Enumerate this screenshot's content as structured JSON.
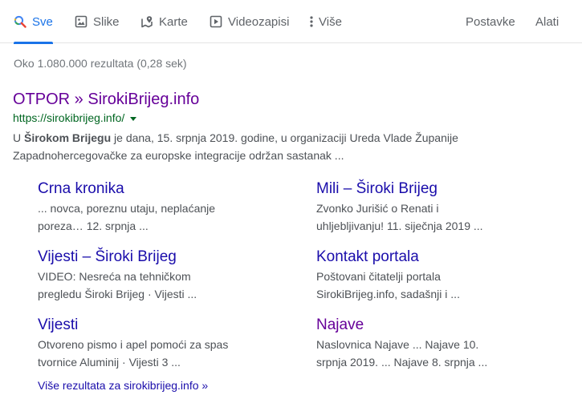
{
  "tabs": {
    "all": "Sve",
    "images": "Slike",
    "maps": "Karte",
    "videos": "Videozapisi",
    "more": "Više",
    "settings": "Postavke",
    "tools": "Alati"
  },
  "stats": "Oko 1.080.000 rezultata (0,28 sek)",
  "result": {
    "title": "OTPOR » SirokiBrijeg.info",
    "url": "https://sirokibrijeg.info/",
    "snippet_pre": "U ",
    "snippet_bold": "Širokom Brijegu",
    "snippet_post": " je dana, 15. srpnja 2019. godine, u organizaciji Ureda Vlade Županije Zapadnohercegovačke za europske integracije održan sastanak ..."
  },
  "sitelinks": [
    {
      "title": "Crna kronika",
      "desc": "... novca, poreznu utaju, neplaćanje poreza… 12. srpnja ..."
    },
    {
      "title": "Mili – Široki Brijeg",
      "desc": "Zvonko Jurišić o Renati i uhljebljivanju! 11. siječnja 2019 ..."
    },
    {
      "title": "Vijesti – Široki Brijeg",
      "desc": "VIDEO: Nesreća na tehničkom pregledu Široki Brijeg · Vijesti ..."
    },
    {
      "title": "Kontakt portala",
      "desc": "Poštovani čitatelji portala SirokiBrijeg.info, sadašnji i ..."
    },
    {
      "title": "Vijesti",
      "desc": "Otvoreno pismo i apel pomoći za spas tvornice Aluminij · Vijesti 3 ..."
    },
    {
      "title": "Najave",
      "desc": "Naslovnica Najave ... Najave 10. srpnja 2019. ... Najave 8. srpnja ..."
    }
  ],
  "more_results": "Više rezultata za sirokibrijeg.info »",
  "colors": {
    "accent": "#1a73e8",
    "link": "#1a0dab",
    "visited": "#660099",
    "url": "#006621"
  }
}
